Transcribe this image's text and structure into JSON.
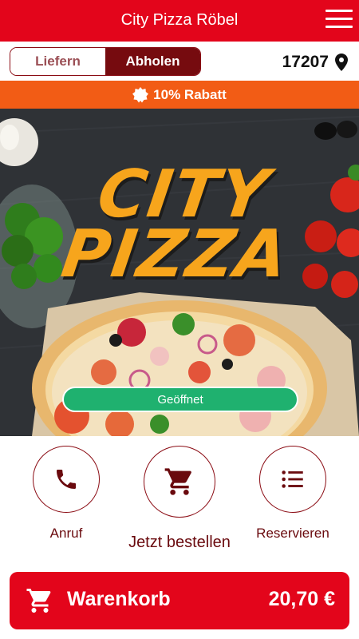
{
  "header": {
    "title": "City Pizza Röbel"
  },
  "mode": {
    "delivery_label": "Liefern",
    "pickup_label": "Abholen",
    "selected": "Abholen",
    "zip": "17207"
  },
  "promo": {
    "text": "10% Rabatt"
  },
  "hero": {
    "brand_line1": "CITY",
    "brand_line2": "PIZZA",
    "status": "Geöffnet"
  },
  "actions": [
    {
      "label": "Anruf",
      "icon": "phone-icon"
    },
    {
      "label": "Jetzt bestellen",
      "icon": "cart-icon"
    },
    {
      "label": "Reservieren",
      "icon": "list-icon"
    }
  ],
  "cart": {
    "label": "Warenkorb",
    "total": "20,70 €"
  },
  "colors": {
    "primary": "#e3051b",
    "dark_red": "#760b0f",
    "promo": "#f25c15",
    "status": "#1fb16f"
  }
}
